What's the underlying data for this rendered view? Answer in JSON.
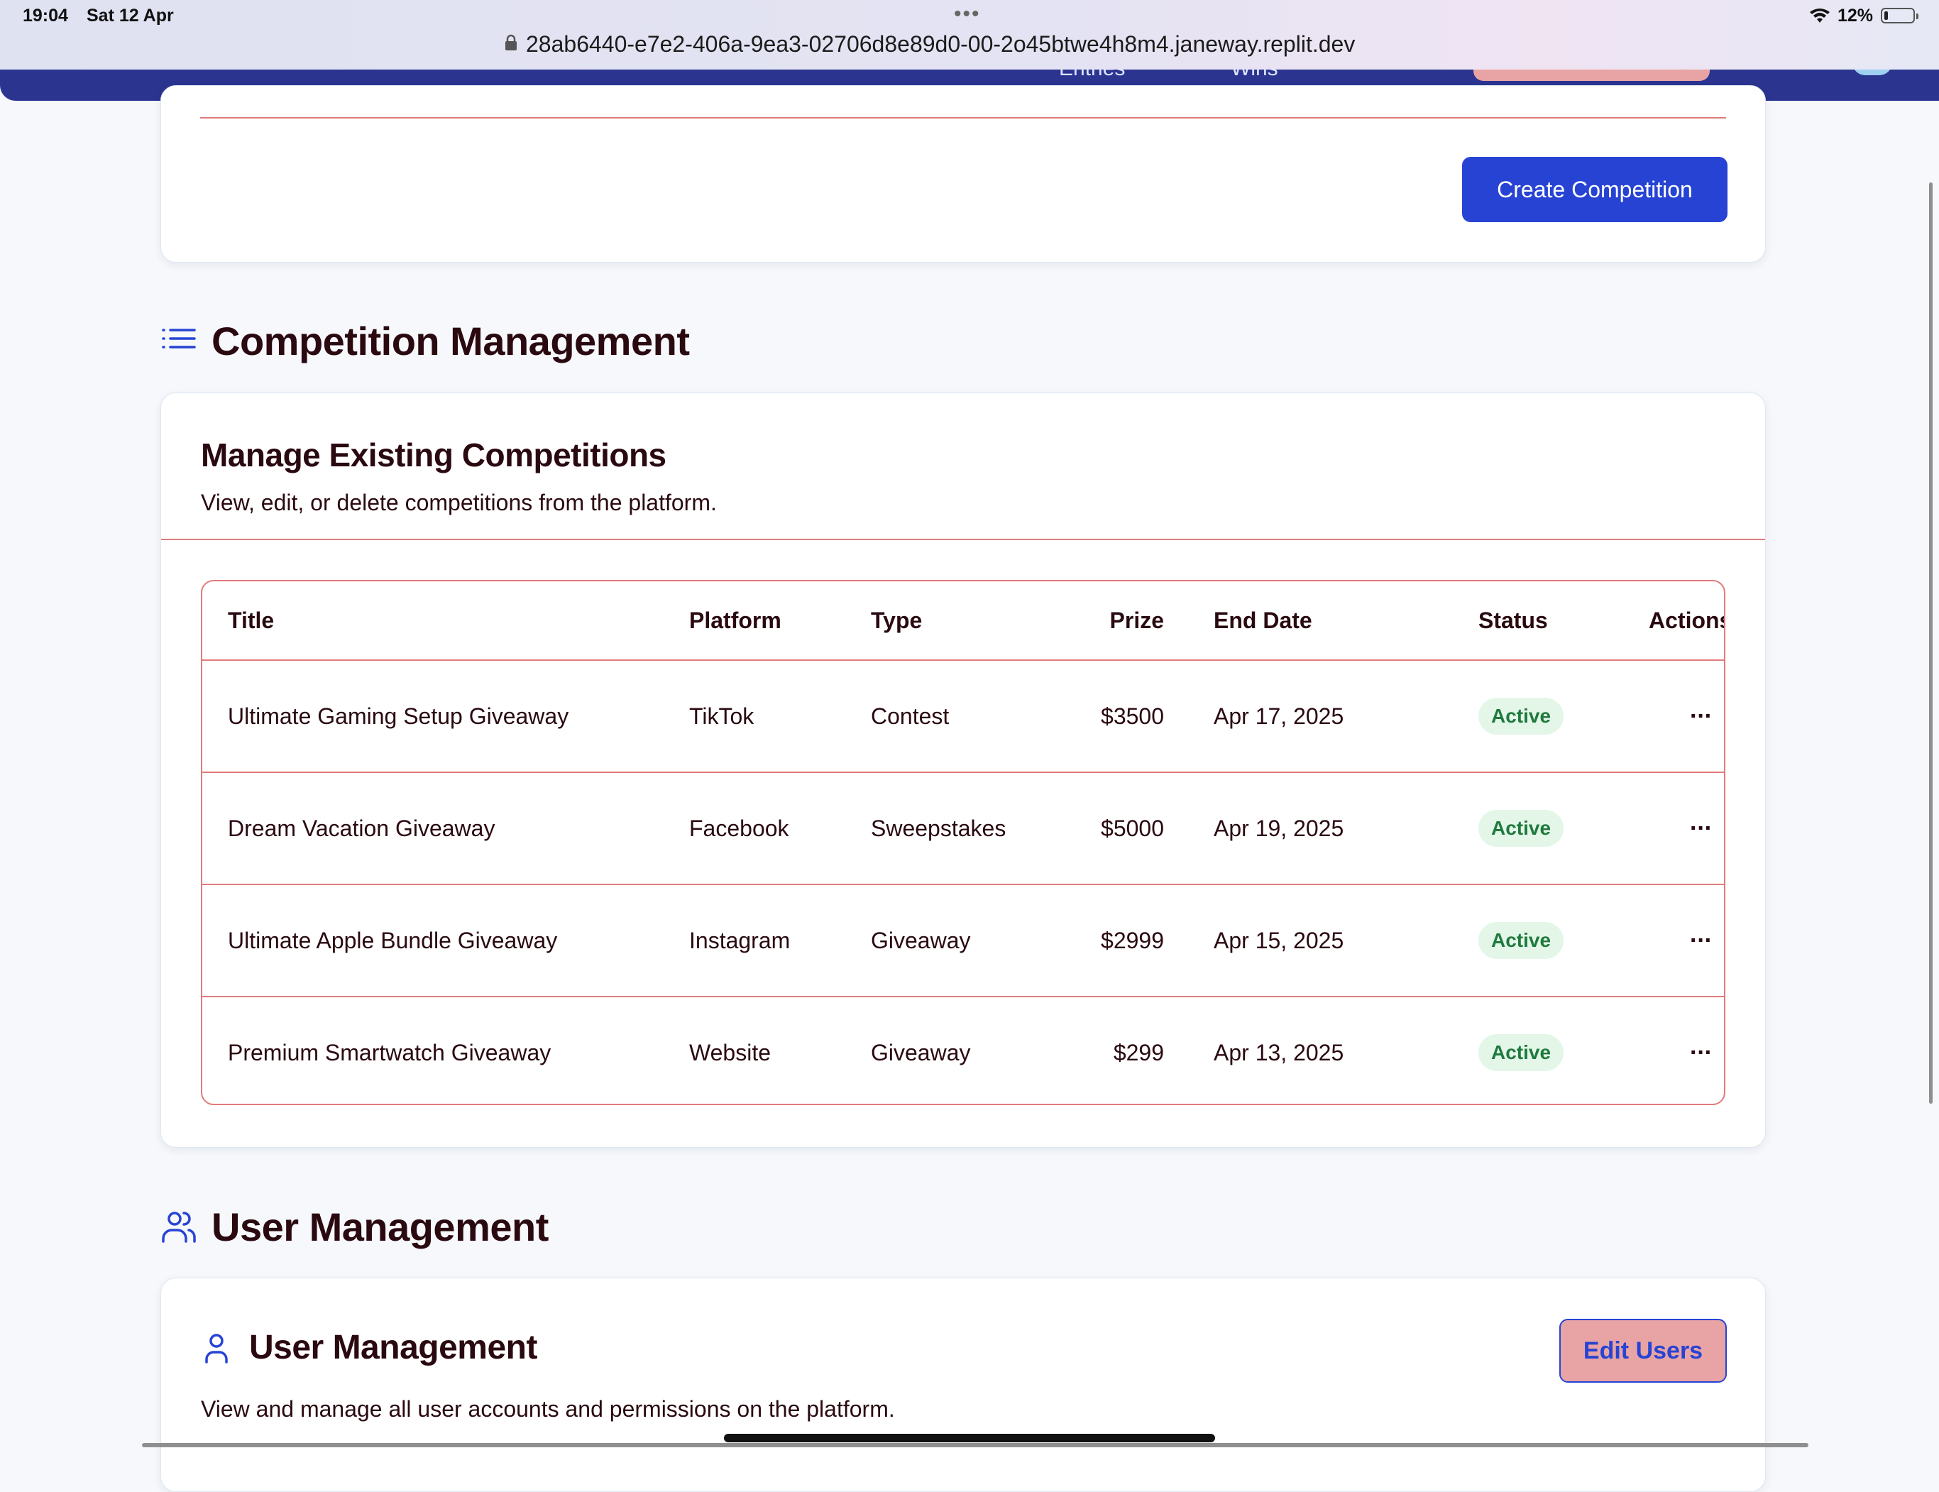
{
  "status_bar": {
    "time": "19:04",
    "date": "Sat 12 Apr",
    "battery": "12%",
    "url": "28ab6440-e7e2-406a-9ea3-02706d8e89d0-00-2o45btwe4h8m4.janeway.replit.dev"
  },
  "nav": {
    "items": [
      "Entries",
      "Wins"
    ]
  },
  "create_section": {
    "button_label": "Create Competition"
  },
  "competition_section": {
    "heading": "Competition Management",
    "icon": "list-icon",
    "card_title": "Manage Existing Competitions",
    "card_description": "View, edit, or delete competitions from the platform.",
    "columns": [
      "Title",
      "Platform",
      "Type",
      "Prize",
      "End Date",
      "Status",
      "Actions"
    ],
    "rows": [
      {
        "title": "Ultimate Gaming Setup Giveaway",
        "platform": "TikTok",
        "type": "Contest",
        "prize": "$3500",
        "end_date": "Apr 17, 2025",
        "status": "Active",
        "actions": "···"
      },
      {
        "title": "Dream Vacation Giveaway",
        "platform": "Facebook",
        "type": "Sweepstakes",
        "prize": "$5000",
        "end_date": "Apr 19, 2025",
        "status": "Active",
        "actions": "···"
      },
      {
        "title": "Ultimate Apple Bundle Giveaway",
        "platform": "Instagram",
        "type": "Giveaway",
        "prize": "$2999",
        "end_date": "Apr 15, 2025",
        "status": "Active",
        "actions": "···"
      },
      {
        "title": "Premium Smartwatch Giveaway",
        "platform": "Website",
        "type": "Giveaway",
        "prize": "$299",
        "end_date": "Apr 13, 2025",
        "status": "Active",
        "actions": "···"
      }
    ]
  },
  "user_section": {
    "heading": "User Management",
    "icon": "users-icon",
    "card_title": "User Management",
    "card_icon": "user-icon",
    "card_description": "View and manage all user accounts and permissions on the platform.",
    "edit_button": "Edit Users"
  },
  "colors": {
    "primary": "#2743d4",
    "nav_bg": "#2b3590",
    "divider": "#e27b7b",
    "heading_text": "#2a0a10",
    "badge_bg": "#e3f6e8",
    "badge_text": "#1f7a3d",
    "edit_button_bg": "#e8a4a4"
  }
}
